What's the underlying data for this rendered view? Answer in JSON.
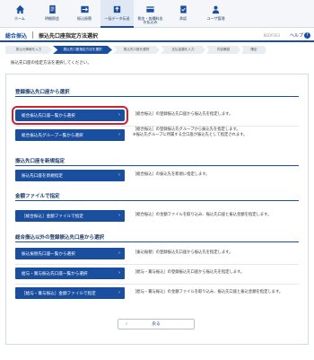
{
  "nav": [
    {
      "label": "ホーム",
      "icon": "home-icon"
    },
    {
      "label": "明細照会",
      "icon": "document-icon"
    },
    {
      "label": "振込振替",
      "icon": "transfer-icon"
    },
    {
      "label": "一括データ伝送",
      "icon": "upload-icon"
    },
    {
      "label": "税金・各種料金\nの払込み",
      "icon": "tax-icon"
    },
    {
      "label": "承認",
      "icon": "stamp-icon"
    },
    {
      "label": "ユーザ管理",
      "icon": "user-icon"
    }
  ],
  "title": {
    "section": "総合振込",
    "page": "振込先口座指定方法選択",
    "code": "BSOF003",
    "help": "ヘルプ",
    "help_icon": "?"
  },
  "steps": [
    "振込元情報を入力",
    "振込先口座指定方法を選択",
    "振込先口座を選択",
    "支払金額を入力",
    "内容確認",
    "確定"
  ],
  "intro": "振込先口座の指定方法を選択してください。",
  "sections": {
    "registered": {
      "title": "登録振込先口座から選択",
      "btn1": "総合振込先口座一覧から選択",
      "desc1": "［総合振込］の登録振込先口座から振込先を指定します。",
      "btn2": "総合振込先グループ一覧から選択",
      "desc2": "［総合振込］の登録振込先グループから振込先を指定します。\n※振込先グループに所属する全口座が振込先として指定されます。"
    },
    "new": {
      "title": "振込先口座を新規指定",
      "btn1": "振込先口座を新規指定",
      "desc1": "［総合振込］の振込先を新規に指定します。"
    },
    "file": {
      "title": "金額ファイルで指定",
      "btn1": "［総合振込］金額ファイルで指定",
      "desc1": "［総合振込］の金額ファイルを取り込み、振込先口座と振込金額を指定します。"
    },
    "other": {
      "title": "総合振込以外の登録振込先口座から選択",
      "btn1": "振込振替先口座一覧から選択",
      "desc1": "［振込振替］の登録振込先口座から振込先を指定します。",
      "btn2": "給与・賞与振込先口座一覧から選択",
      "desc2": "［給与・賞与振込］の登録振込先口座から振込先を指定します。",
      "btn3": "［給与・賞与振込］金額ファイルで指定",
      "desc3": "［給与・賞与振込］の金額ファイルを取り込み、振込先口座と振込金額を指定します。"
    }
  },
  "back": "戻る",
  "chevron": "›",
  "back_chevron": "‹",
  "colors": {
    "primary": "#1a4fa0",
    "highlight": "#d02030"
  }
}
